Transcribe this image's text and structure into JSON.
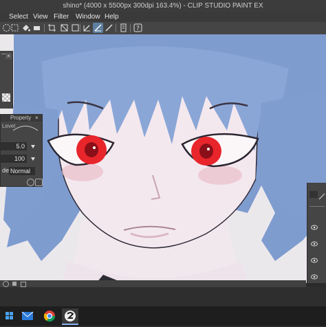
{
  "window": {
    "title": "shino* (4000 x 5500px 300dpi 163.4%) - CLIP STUDIO PAINT EX"
  },
  "menu": {
    "items": [
      "Select",
      "View",
      "Filter",
      "Window",
      "Help"
    ]
  },
  "tool_property": {
    "title": "Property",
    "level_label": "Level",
    "value1": "5.0",
    "value2": "100",
    "mode_label": "de",
    "mode_value": "Normal"
  },
  "icons": [
    "menu-icon",
    "lasso-icon",
    "fill-icon",
    "crop-icon",
    "transform-icon",
    "pen-icon",
    "brush-icon",
    "line-icon",
    "ruler-icon",
    "help-icon"
  ]
}
